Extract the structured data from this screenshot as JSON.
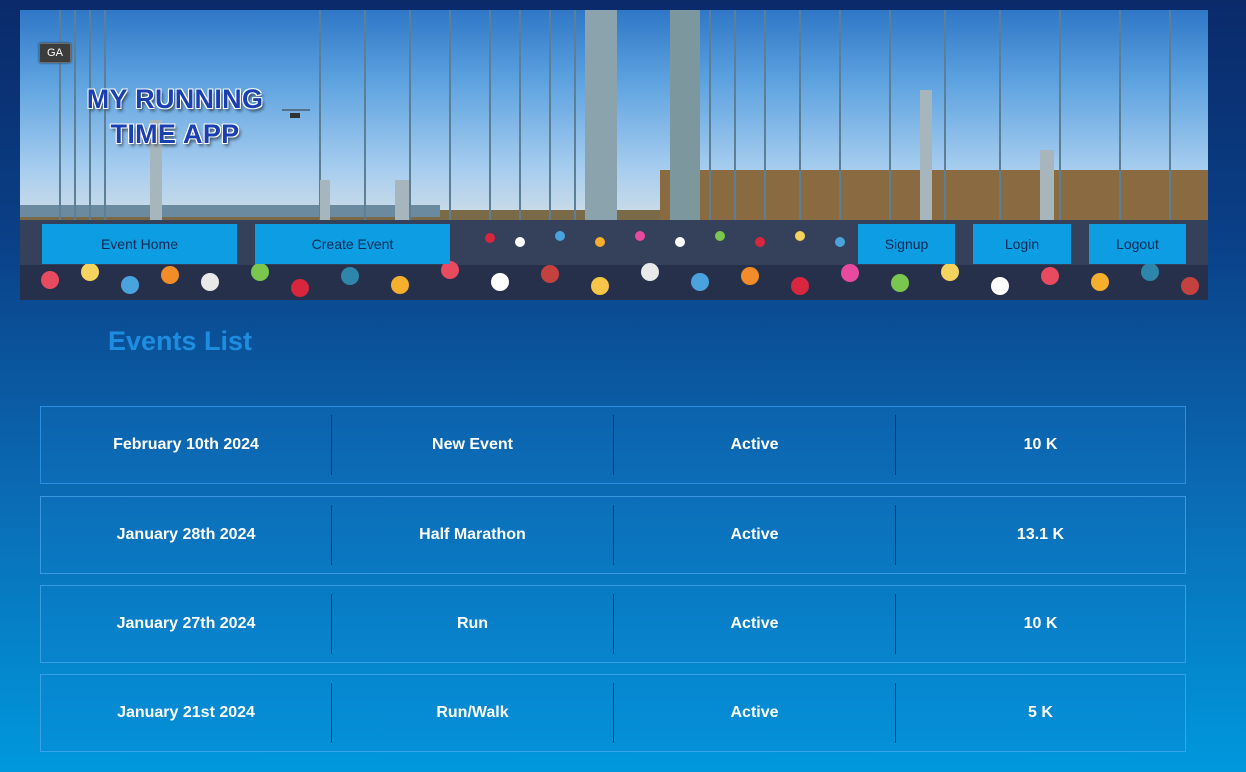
{
  "header": {
    "badge": "GA",
    "app_title": "MY RUNNING TIME APP"
  },
  "nav": {
    "event_home": "Event Home",
    "create_event": "Create Event",
    "signup": "Signup",
    "login": "Login",
    "logout": "Logout"
  },
  "main": {
    "title": "Events List",
    "events": [
      {
        "date": "February 10th 2024",
        "name": "New Event",
        "status": "Active",
        "distance": "10 K"
      },
      {
        "date": "January 28th 2024",
        "name": "Half Marathon",
        "status": "Active",
        "distance": "13.1 K"
      },
      {
        "date": "January 27th 2024",
        "name": "Run",
        "status": "Active",
        "distance": "10 K"
      },
      {
        "date": "January 21st 2024",
        "name": "Run/Walk",
        "status": "Active",
        "distance": "5 K"
      }
    ]
  },
  "colors": {
    "accent": "#0d9de3",
    "title_blue": "#1e8de0",
    "nav_text": "#0b2a55"
  }
}
